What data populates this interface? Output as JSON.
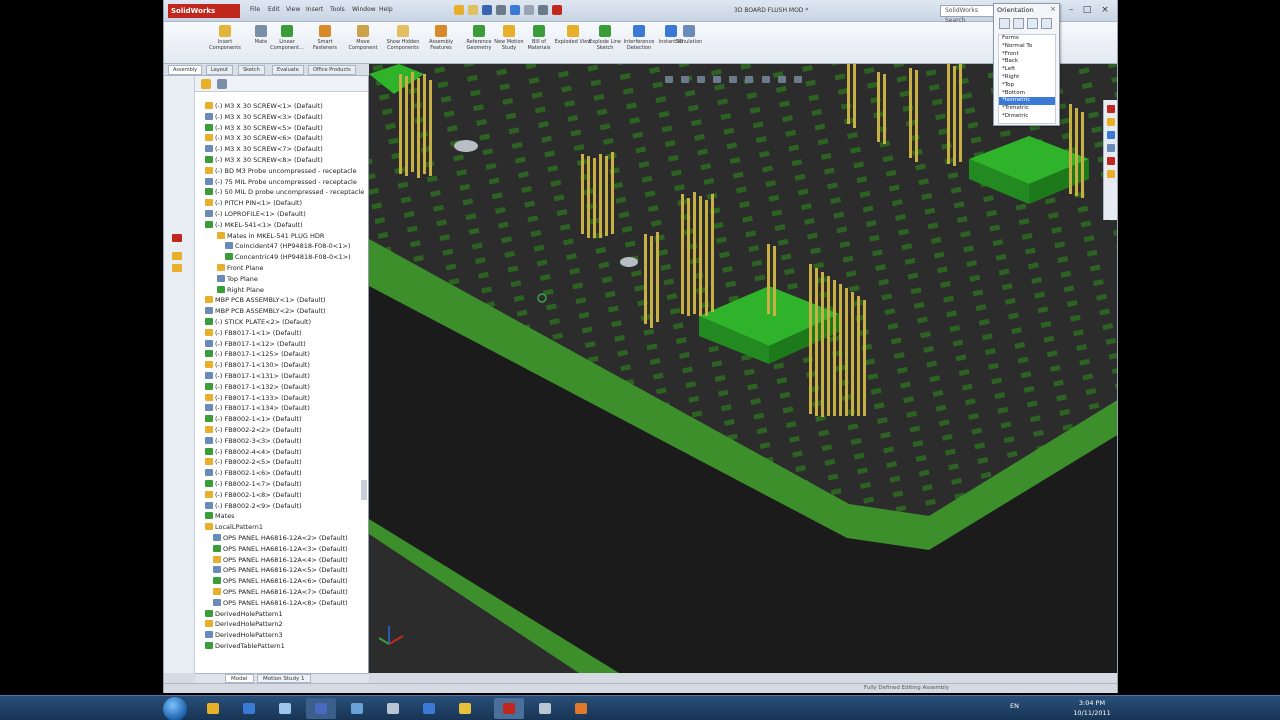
{
  "window": {
    "app_name": "SolidWorks",
    "doc_title": "3D BOARD FLUSH MOD *",
    "search_placeholder": "SolidWorks Search"
  },
  "menubar": {
    "items": [
      "File",
      "Edit",
      "View",
      "Insert",
      "Tools",
      "Window",
      "Help"
    ]
  },
  "ribbon": {
    "buttons": [
      "Insert Components",
      "Mate",
      "Linear Component...",
      "Smart Fasteners",
      "Move Component",
      "Show Hidden Components",
      "Assembly Features",
      "Reference Geometry",
      "New Motion Study",
      "Bill of Materials",
      "Exploded View",
      "Explode Line Sketch",
      "Interference Detection",
      "Instant3D",
      "Simulation"
    ]
  },
  "cmd_tabs": [
    "Assembly",
    "Layout",
    "Sketch",
    "Evaluate",
    "Office Products"
  ],
  "tree": {
    "items": [
      "(-) M3 X 30 SCREW<1> (Default)",
      "(-) M3 X 30 SCREW<3> (Default)",
      "(-) M3 X 30 SCREW<5> (Default)",
      "(-) M3 X 30 SCREW<6> (Default)",
      "(-) M3 X 30 SCREW<7> (Default)",
      "(-) M3 X 30 SCREW<8> (Default)",
      "(-) BD M3 Probe uncompressed - receptacle",
      "(-) 75 MIL Probe uncompressed - receptacle",
      "(-) 50 MIL D probe uncompressed - receptacle",
      "(-) PITCH PIN<1> (Default)",
      "(-) LOPROFILE<1> (Default)",
      "(-) MKEL-541<1> (Default)",
      "Mates in MKEL-541 PLUG HDR",
      "Coincident47 (HP94818-F08-0<1>)",
      "Concentric49 (HP94818-F08-0<1>)",
      "Front Plane",
      "Top Plane",
      "Right Plane",
      "MBP PCB ASSEMBLY<1> (Default)",
      "MBP PCB ASSEMBLY<2> (Default)",
      "(-) STICK PLATE<2> (Default)",
      "(-) FB8017-1<1> (Default)",
      "(-) FB8017-1<12> (Default)",
      "(-) FB8017-1<125> (Default)",
      "(-) FB8017-1<130> (Default)",
      "(-) FB8017-1<131> (Default)",
      "(-) FB8017-1<132> (Default)",
      "(-) FB8017-1<133> (Default)",
      "(-) FB8017-1<134> (Default)",
      "(-) FB8002-1<1> (Default)",
      "(-) FB8002-2<2> (Default)",
      "(-) FB8002-3<3> (Default)",
      "(-) FB8002-4<4> (Default)",
      "(-) FB8002-2<5> (Default)",
      "(-) FB8002-1<6> (Default)",
      "(-) FB8002-1<7> (Default)",
      "(-) FB8002-1<8> (Default)",
      "(-) FB8002-2<9> (Default)",
      "Mates",
      "LocalLPattern1",
      "OPS PANEL HA6816-12A<2> (Default)",
      "OPS PANEL HA6816-12A<3> (Default)",
      "OPS PANEL HA6816-12A<4> (Default)",
      "OPS PANEL HA6816-12A<5> (Default)",
      "OPS PANEL HA6816-12A<6> (Default)",
      "OPS PANEL HA6816-12A<7> (Default)",
      "OPS PANEL HA6816-12A<8> (Default)",
      "DerivedHolePattern1",
      "DerivedHolePattern2",
      "DerivedHolePattern3",
      "DerivedTablePattern1"
    ]
  },
  "bottom_tabs": [
    "Model",
    "Motion Study 1"
  ],
  "status": {
    "text": "Fully Defined   Editing Assembly"
  },
  "orientation": {
    "title": "Orientation",
    "views": [
      "Forms",
      "*Normal To",
      "*Front",
      "*Back",
      "*Left",
      "*Right",
      "*Top",
      "*Bottom",
      "*Isometric",
      "*Trimetric",
      "*Dimetric"
    ],
    "selected_index": 8
  },
  "taskbar": {
    "tray_lang": "EN",
    "time": "3:04 PM",
    "date": "10/11/2011"
  },
  "colors": {
    "pcb": "#2c2c2c",
    "pad": "#3d8f2c",
    "component": "#2fb32a",
    "pins": "#c8b045",
    "accent": "#c0281d"
  }
}
